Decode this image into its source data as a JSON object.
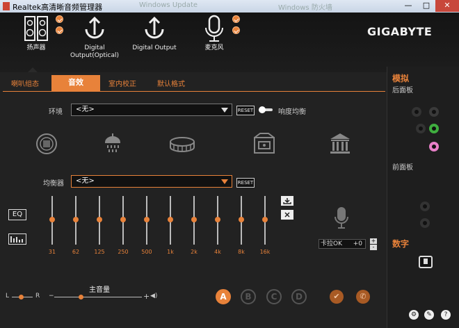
{
  "window": {
    "title": "Realtek高清晰音频管理器",
    "bg_tabs": [
      "Windows Update",
      "Windows 防火墙"
    ],
    "minimize": "—",
    "maximize": "□",
    "close": "✕"
  },
  "header": {
    "devices": [
      {
        "label": "扬声器",
        "icon": "speaker-icon"
      },
      {
        "label": "Digital Output(Optical)",
        "icon": "digital-output-optical-icon"
      },
      {
        "label": "Digital Output",
        "icon": "digital-output-icon"
      },
      {
        "label": "麦克风",
        "icon": "microphone-icon"
      }
    ],
    "brand": "GIGABYTE"
  },
  "tabs": [
    {
      "label": "喇叭组态",
      "active": false
    },
    {
      "label": "音效",
      "active": true
    },
    {
      "label": "室内校正",
      "active": false
    },
    {
      "label": "默认格式",
      "active": false
    }
  ],
  "environment": {
    "label": "环境",
    "value": "<无>",
    "reset": "RESET",
    "loudness_label": "响度均衡",
    "loudness_on": false,
    "icons": [
      "stone-corridor-icon",
      "shower-icon",
      "stadium-icon",
      "room-icon",
      "concert-hall-icon"
    ]
  },
  "equalizer": {
    "label": "均衡器",
    "value": "<无>",
    "reset": "RESET",
    "bands": [
      "31",
      "62",
      "125",
      "250",
      "500",
      "1k",
      "2k",
      "4k",
      "8k",
      "16k"
    ],
    "eq_button": "EQ"
  },
  "karaoke": {
    "label": "卡拉OK",
    "value": "+0",
    "plus": "+",
    "minus": "-"
  },
  "volume": {
    "left": "L",
    "right": "R",
    "label": "主音量",
    "plus": "+",
    "speaker_glyph": "◀)"
  },
  "profiles": [
    "A",
    "B",
    "C",
    "D"
  ],
  "right_panel": {
    "analog_title": "模拟",
    "back_panel": "后面板",
    "front_panel": "前面板",
    "digital_title": "数字",
    "jack_colors": {
      "green": "#3fae3f",
      "pink": "#e880c8",
      "dim": "#3a3a3a"
    }
  },
  "colors": {
    "accent": "#e8823a",
    "background": "#222222"
  }
}
